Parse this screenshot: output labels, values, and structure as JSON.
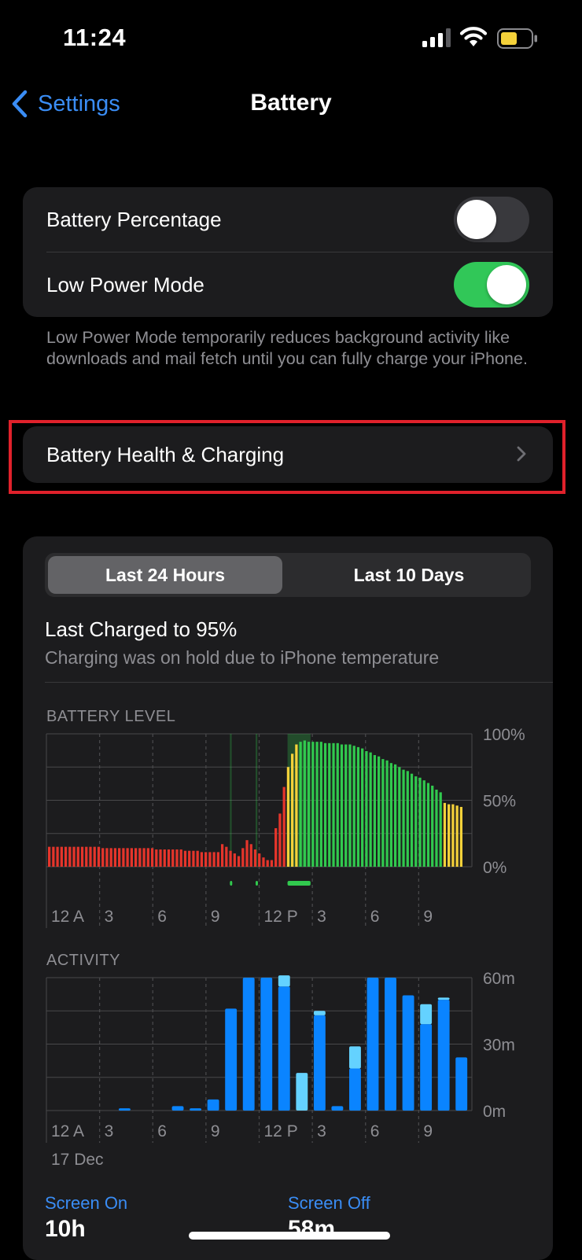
{
  "status_bar": {
    "time": "11:24"
  },
  "nav": {
    "back_label": "Settings",
    "title": "Battery"
  },
  "toggles": {
    "battery_percentage": {
      "label": "Battery Percentage",
      "on": false
    },
    "low_power_mode": {
      "label": "Low Power Mode",
      "on": true
    }
  },
  "low_power_note": "Low Power Mode temporarily reduces background activity like downloads and mail fetch until you can fully charge your iPhone.",
  "health_row": {
    "label": "Battery Health & Charging"
  },
  "segmented": {
    "options": [
      "Last 24 Hours",
      "Last 10 Days"
    ],
    "selected": 0
  },
  "last_charged": {
    "title": "Last Charged to 95%",
    "subtitle": "Charging was on hold due to iPhone temperature"
  },
  "colors": {
    "red": "#e5352b",
    "yellow": "#f4d13a",
    "green": "#31c94e",
    "blue": "#0a84ff",
    "light_blue": "#64d2ff",
    "toggle_on": "#31c758",
    "link": "#3a8df5"
  },
  "x_ticks": [
    "12 A",
    "3",
    "6",
    "9",
    "12 P",
    "3",
    "6",
    "9"
  ],
  "chart_data": [
    {
      "type": "bar",
      "title": "BATTERY LEVEL",
      "y_ticks": [
        "100%",
        "50%",
        "0%"
      ],
      "ylim": [
        0,
        100
      ],
      "x_range_hours": [
        0,
        24
      ],
      "grid": true,
      "charging_periods_hours": [
        [
          10.35,
          10.45
        ],
        [
          11.8,
          11.9
        ],
        [
          13.6,
          14.9
        ]
      ],
      "series": [
        {
          "values": [
            15,
            15,
            15,
            15,
            15,
            15,
            15,
            15,
            15,
            15,
            15,
            15,
            15,
            14,
            14,
            14,
            14,
            14,
            14,
            14,
            14,
            14,
            14,
            14,
            14,
            14,
            13,
            13,
            13,
            13,
            13,
            13,
            13,
            12,
            12,
            12,
            12,
            11,
            11,
            11,
            11,
            11,
            17,
            15,
            12,
            10,
            8,
            14,
            20,
            17,
            13,
            10,
            7,
            5,
            5,
            29,
            40,
            60,
            75,
            85,
            92,
            94,
            95,
            94,
            94,
            94,
            94,
            93,
            93,
            93,
            93,
            92,
            92,
            92,
            91,
            90,
            89,
            87,
            86,
            84,
            83,
            81,
            80,
            78,
            77,
            75,
            73,
            72,
            70,
            68,
            67,
            65,
            63,
            61,
            58,
            56,
            48,
            47,
            47,
            46,
            45
          ],
          "colors": "red until ~13.8 h, yellow 14.0–14.3 h, green afterwards, yellow at the end (below ~47%)"
        }
      ]
    },
    {
      "type": "bar",
      "title": "ACTIVITY",
      "y_ticks": [
        "60m",
        "30m",
        "0m"
      ],
      "ylim": [
        0,
        60
      ],
      "date_label": "17 Dec",
      "categories_hours": [
        0,
        1,
        2,
        3,
        4,
        5,
        6,
        7,
        8,
        9,
        10,
        11,
        12,
        13,
        14,
        15,
        16,
        17,
        18,
        19,
        20,
        21,
        22,
        23
      ],
      "series": [
        {
          "name": "Screen On",
          "values": [
            0,
            0,
            0,
            0,
            1,
            0,
            0,
            2,
            1,
            5,
            46,
            60,
            60,
            56,
            0,
            43,
            2,
            19,
            60,
            60,
            52,
            39,
            50,
            24
          ]
        },
        {
          "name": "Screen Off",
          "values": [
            0,
            0,
            0,
            0,
            0,
            0,
            0,
            0,
            0,
            0,
            0,
            0,
            0,
            5,
            17,
            2,
            0,
            10,
            0,
            0,
            0,
            9,
            1,
            0
          ]
        }
      ]
    }
  ],
  "totals": {
    "screen_on": {
      "label": "Screen On",
      "value": "10h"
    },
    "screen_off": {
      "label": "Screen Off",
      "value": "58m"
    }
  }
}
